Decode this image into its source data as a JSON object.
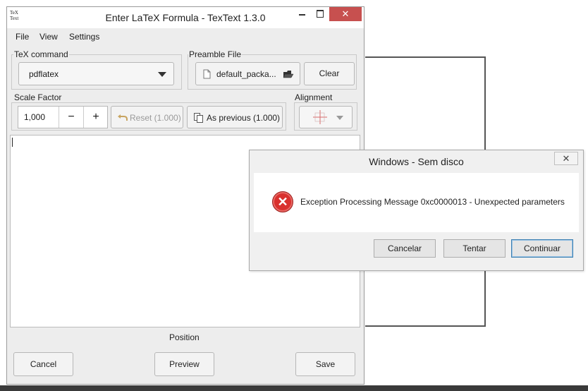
{
  "textext": {
    "title": "Enter LaTeX Formula - TexText 1.3.0",
    "icon_text_1": "TeX",
    "icon_text_2": "Text",
    "menu": [
      "File",
      "View",
      "Settings"
    ],
    "tex_command": {
      "label": "TeX command",
      "value": "pdflatex"
    },
    "preamble": {
      "label": "Preamble File",
      "file": "default_packa...",
      "clear": "Clear"
    },
    "scale": {
      "label": "Scale Factor",
      "value": "1,000",
      "minus": "−",
      "plus": "+",
      "reset": "Reset (1.000)",
      "previous": "As previous (1.000)"
    },
    "alignment": {
      "label": "Alignment"
    },
    "position_label": "Position",
    "buttons": {
      "cancel": "Cancel",
      "preview": "Preview",
      "save": "Save"
    }
  },
  "dialog": {
    "title": "Windows - Sem disco",
    "message": "Exception Processing Message 0xc0000013 - Unexpected parameters",
    "buttons": {
      "cancel": "Cancelar",
      "retry": "Tentar",
      "continue": "Continuar"
    }
  },
  "colors": {
    "close_red": "#c7504f",
    "error_red": "#d9312e"
  }
}
